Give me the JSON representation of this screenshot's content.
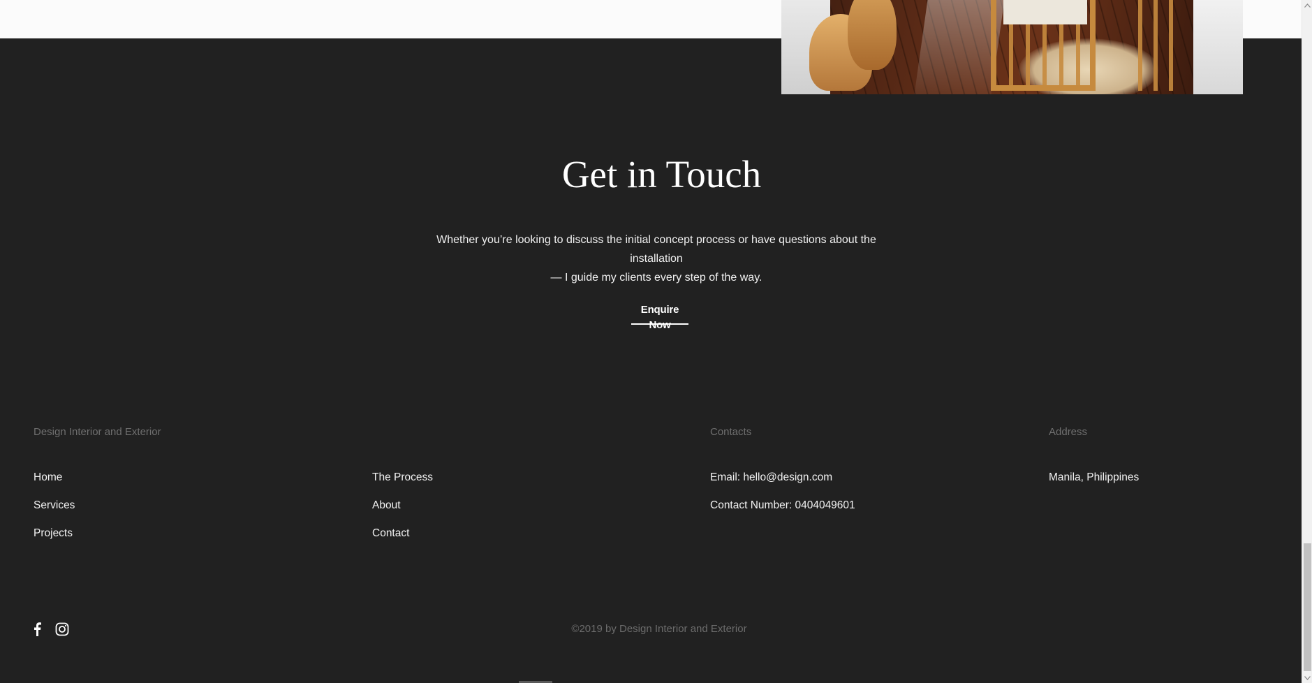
{
  "contact_section": {
    "title": "Get in Touch",
    "description_line1": "Whether you’re looking to discuss the initial concept process or have questions about the installation",
    "description_line2": "— I guide my clients every step of the way.",
    "cta_label": "Enquire Now"
  },
  "footer": {
    "brand_heading": "Design Interior and Exterior",
    "nav_col1": [
      {
        "label": "Home"
      },
      {
        "label": "Services"
      },
      {
        "label": "Projects"
      }
    ],
    "nav_col2": [
      {
        "label": "The Process"
      },
      {
        "label": "About"
      },
      {
        "label": "Contact"
      }
    ],
    "contacts_heading": "Contacts",
    "email": "Email: hello@design.com",
    "phone": "Contact Number: 0404049601",
    "address_heading": "Address",
    "address": "Manila, Philippines",
    "social_icons": [
      "facebook-icon",
      "instagram-icon"
    ],
    "copyright": "©2019 by Design Interior and Exterior"
  },
  "colors": {
    "background": "#212121",
    "top_strip": "#fbfbfb",
    "text": "#ffffff",
    "muted": "#6f6f6f"
  }
}
